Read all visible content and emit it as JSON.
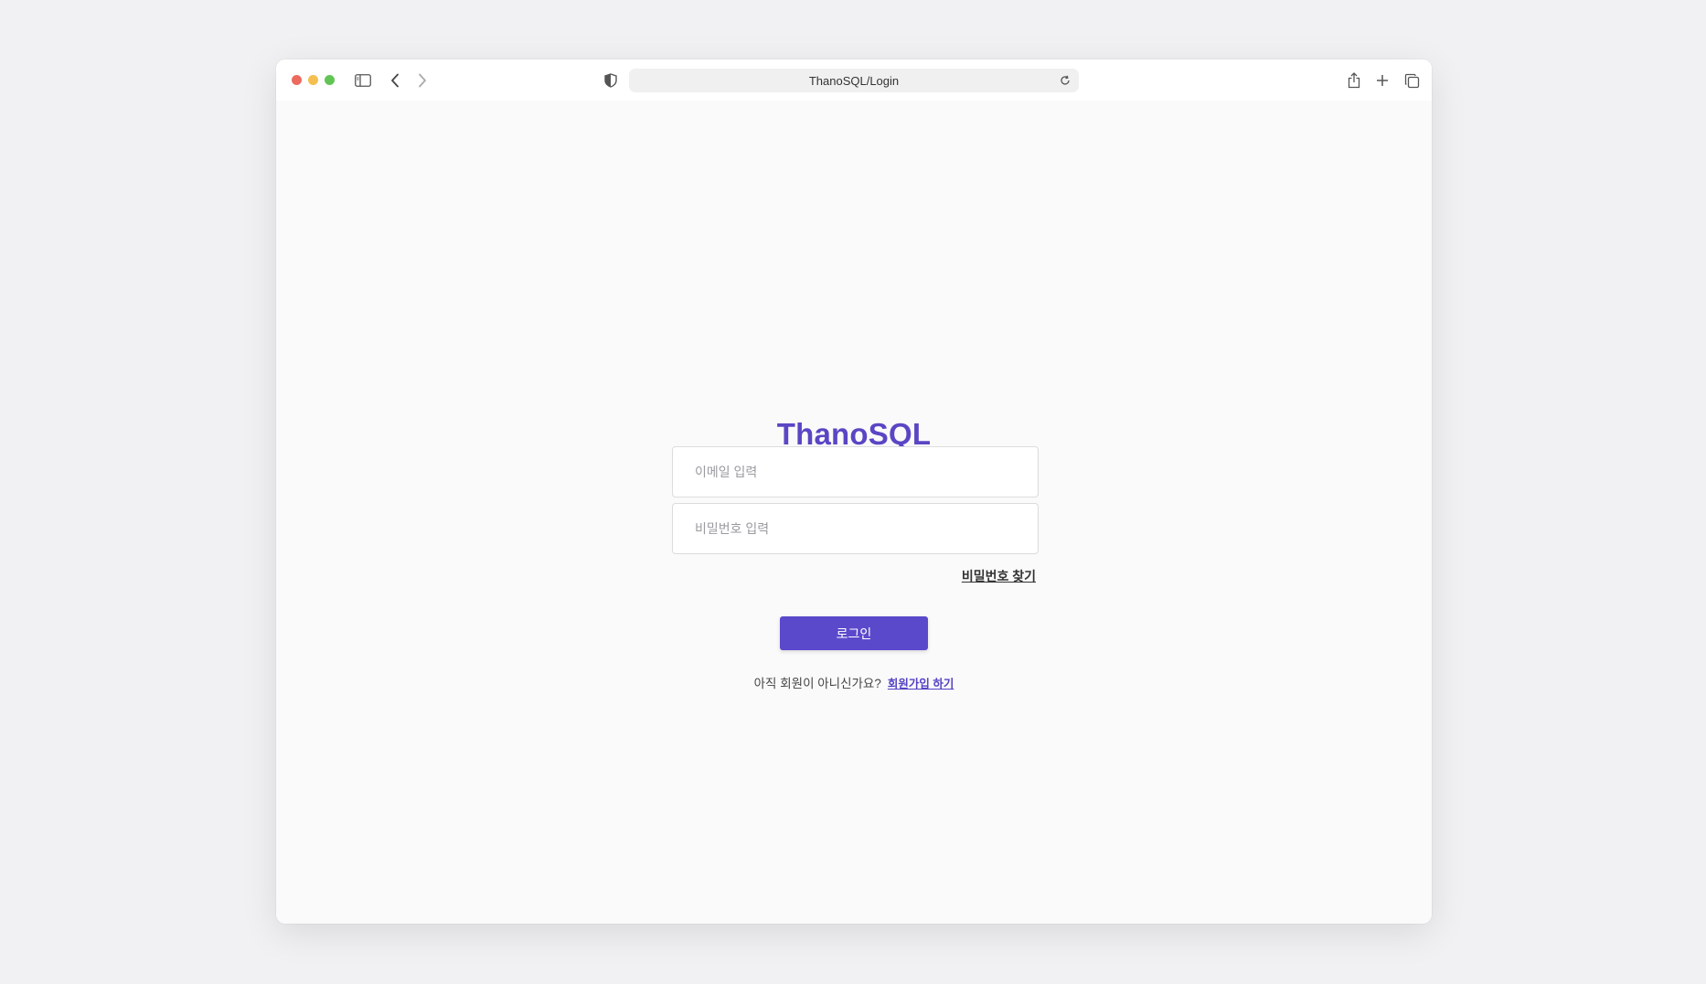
{
  "browser": {
    "url": "ThanoSQL/Login",
    "icons": {
      "sidebar": "sidebar-icon",
      "back": "chevron-left-icon",
      "forward": "chevron-right-icon",
      "shield": "shield-icon",
      "reload": "reload-icon",
      "share": "share-icon",
      "new_tab": "plus-icon",
      "tabs": "tabs-overview-icon"
    }
  },
  "login": {
    "logo": "ThanoSQL",
    "email_placeholder": "이메일 입력",
    "password_placeholder": "비밀번호 입력",
    "forgot_password": "비밀번호 찾기",
    "login_button": "로그인",
    "signup_prompt": "아직 회원이 아니신가요?",
    "signup_link": "회원가입 하기"
  },
  "colors": {
    "brand": "#5a46c4",
    "button": "#5b49cc",
    "background": "#fafafa"
  }
}
